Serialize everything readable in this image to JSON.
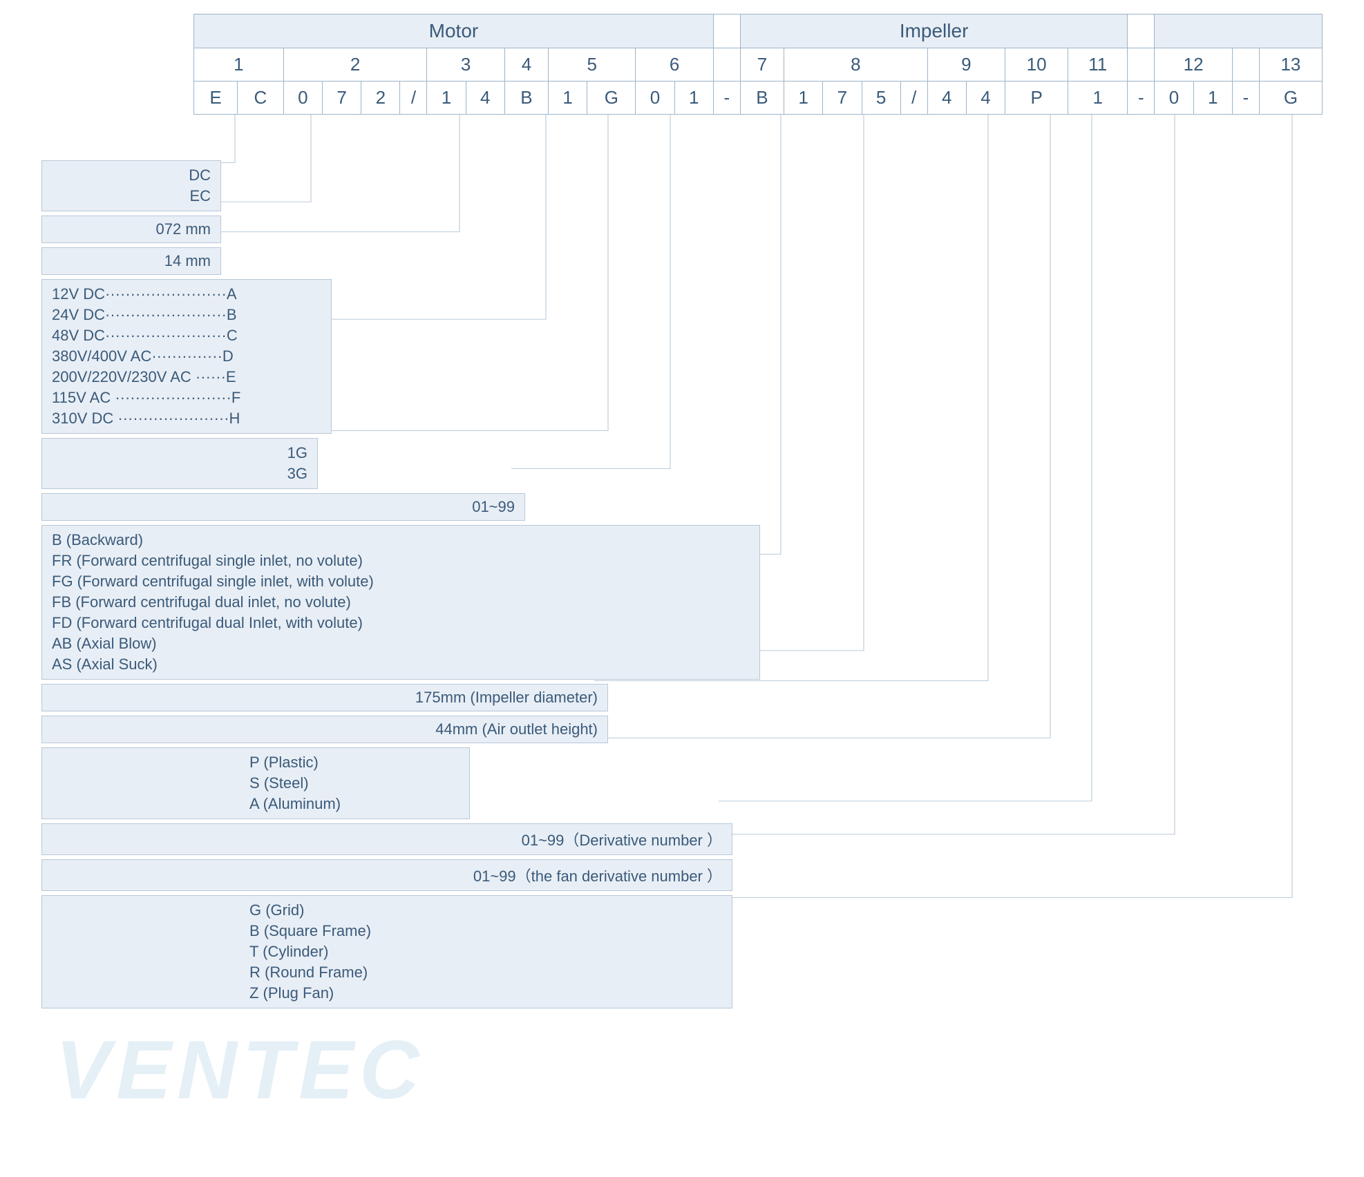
{
  "header": {
    "motor": "Motor",
    "impeller": "Impeller"
  },
  "positions": {
    "p1": "1",
    "p2": "2",
    "p3": "3",
    "p4": "4",
    "p5": "5",
    "p6": "6",
    "p7": "7",
    "p8": "8",
    "p9": "9",
    "p10": "10",
    "p11": "11",
    "p12": "12",
    "p13": "13"
  },
  "code": {
    "c0": "E",
    "c1": "C",
    "c2": "0",
    "c3": "7",
    "c4": "2",
    "c5": "/",
    "c6": "1",
    "c7": "4",
    "c8": "B",
    "c9": "1",
    "c10": "G",
    "c11": "0",
    "c12": "1",
    "d1": "-",
    "c13": "B",
    "c14": "1",
    "c15": "7",
    "c16": "5",
    "c17": "/",
    "c18": "4",
    "c19": "4",
    "c20": "P",
    "c21": "1",
    "d2": "-",
    "c22": "0",
    "c23": "1",
    "d3": "-",
    "c24": "G"
  },
  "legend": {
    "l1a": "DC",
    "l1b": "EC",
    "l2": "072 mm",
    "l3": "14 mm",
    "l4a": "12V DC························A",
    "l4b": "24V DC························B",
    "l4c": "48V DC························C",
    "l4d": "380V/400V AC··············D",
    "l4e": "200V/220V/230V AC ······E",
    "l4f": "115V AC ·······················F",
    "l4g": "310V DC ······················H",
    "l5a": "1G",
    "l5b": "3G",
    "l6": "01~99",
    "l7a": "B (Backward)",
    "l7b": "FR (Forward centrifugal single inlet, no volute)",
    "l7c": "FG (Forward centrifugal single inlet, with volute)",
    "l7d": "FB (Forward centrifugal dual inlet, no volute)",
    "l7e": "FD (Forward centrifugal dual Inlet, with volute)",
    "l7f": "AB (Axial Blow)",
    "l7g": "AS (Axial Suck)",
    "l8": "175mm (Impeller diameter)",
    "l9": "44mm (Air outlet height)",
    "l10a": "P (Plastic)",
    "l10b": "S (Steel)",
    "l10c": "A (Aluminum)",
    "l11": "01~99（Derivative number ）",
    "l12": "01~99（the fan derivative number ）",
    "l13a": "G (Grid)",
    "l13b": "B (Square Frame)",
    "l13c": "T (Cylinder)",
    "l13d": "R (Round Frame)",
    "l13e": "Z (Plug Fan)"
  },
  "watermark": "VENTEC"
}
